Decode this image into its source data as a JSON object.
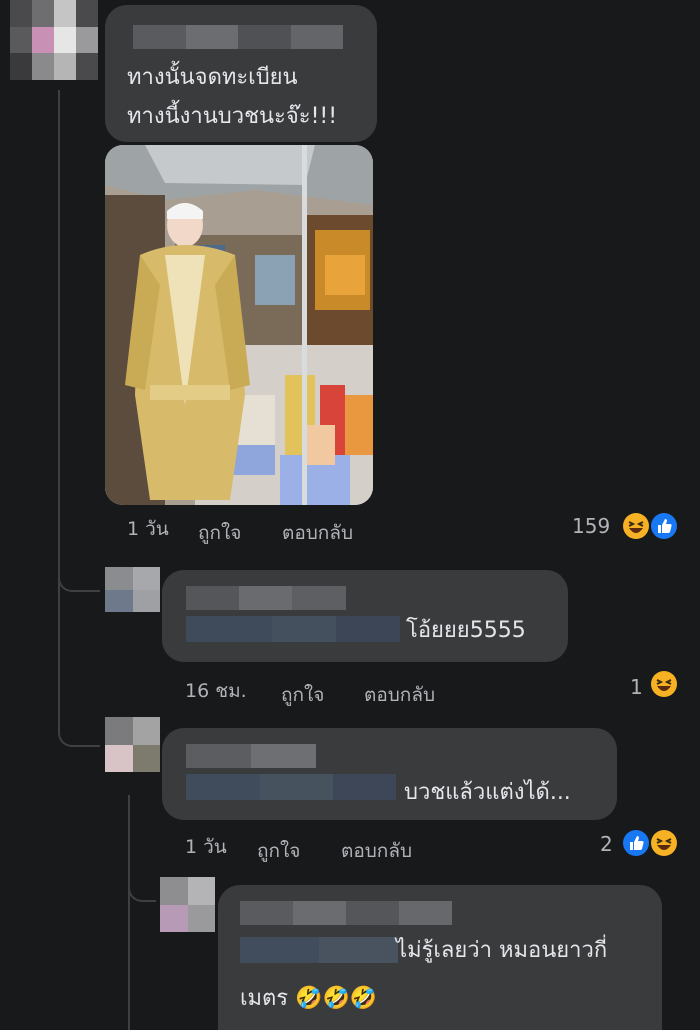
{
  "main_comment": {
    "text_line1": "ทางนั้นจดทะเบียน",
    "text_line2": "ทางนี้งานบวชนะจ๊ะ!!!",
    "time": "1 วัน",
    "like_label": "ถูกใจ",
    "reply_label": "ตอบกลับ",
    "reaction_count": "159",
    "reactions": [
      "laughing-face",
      "thumbs-up"
    ]
  },
  "replies": [
    {
      "text": "โอ้ยยย5555",
      "time": "16 ชม.",
      "like_label": "ถูกใจ",
      "reply_label": "ตอบกลับ",
      "reaction_count": "1",
      "reactions": [
        "laughing-face"
      ]
    },
    {
      "text": "บวชแล้วแต่งได้...",
      "time": "1 วัน",
      "like_label": "ถูกใจ",
      "reply_label": "ตอบกลับ",
      "reaction_count": "2",
      "reactions": [
        "thumbs-up",
        "laughing-face"
      ]
    },
    {
      "text_line1": "ไม่รู้เลยว่า หมอนยาวกี่",
      "text_line2": "เมตร 🤣🤣🤣"
    }
  ],
  "colors": {
    "background": "#18191a",
    "bubble": "#3a3b3c",
    "text": "#e4e6eb",
    "secondary_text": "#b0b3b8",
    "like_blue": "#1877f2",
    "haha_yellow": "#f7b125"
  }
}
